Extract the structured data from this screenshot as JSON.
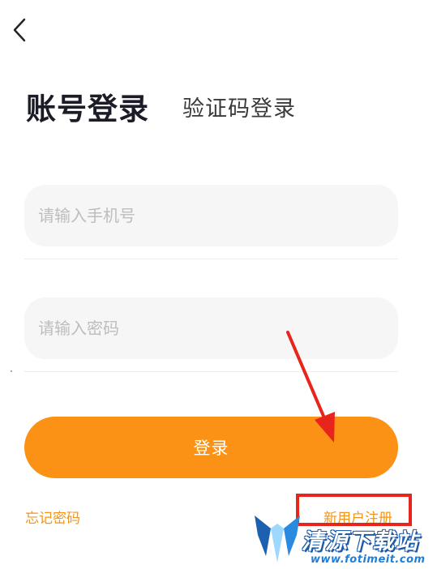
{
  "header": {
    "back_icon": "chevron-left-icon"
  },
  "tabs": {
    "active_label": "账号登录",
    "inactive_label": "验证码登录"
  },
  "form": {
    "phone_placeholder": "请输入手机号",
    "phone_value": "",
    "password_placeholder": "请输入密码",
    "password_value": ""
  },
  "actions": {
    "login_label": "登录",
    "forgot_label": "忘记密码",
    "register_label": "新用户注册"
  },
  "watermark": {
    "title": "清源下载站",
    "url": "www.fotimeit.com"
  },
  "colors": {
    "accent": "#fb9216",
    "link": "#f0961c",
    "annotation": "#e8251c",
    "field_bg": "#f6f6f7"
  }
}
